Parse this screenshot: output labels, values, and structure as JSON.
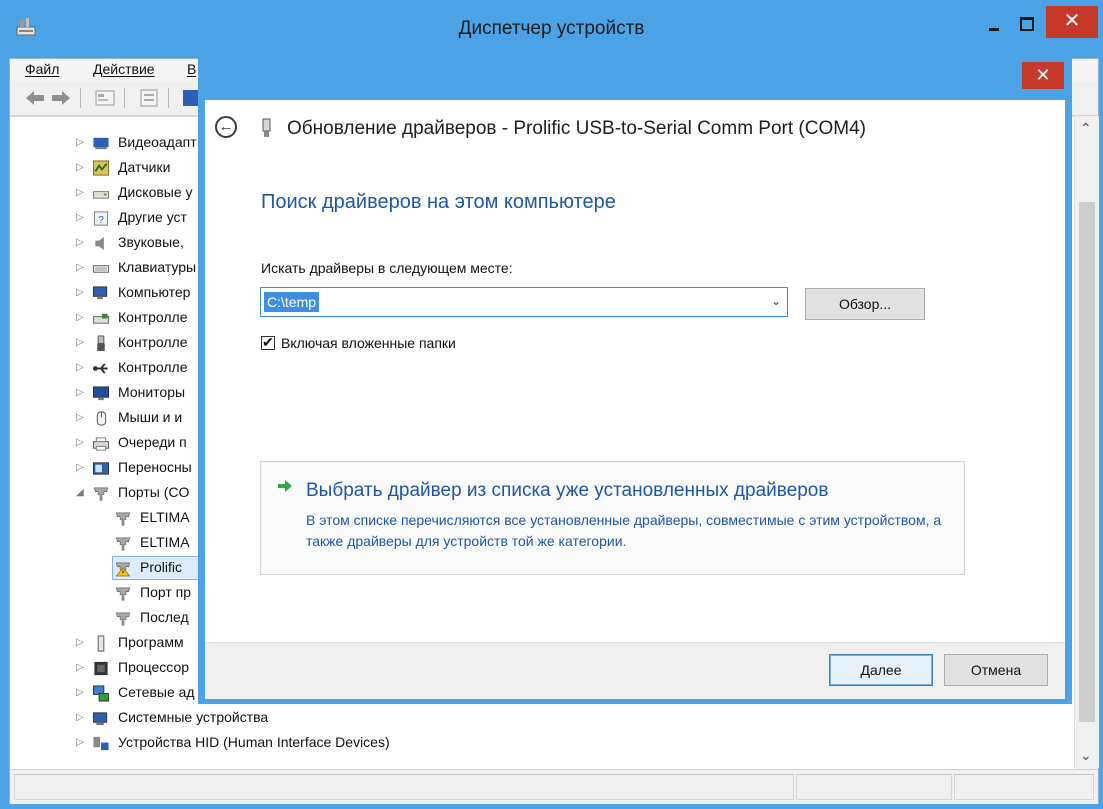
{
  "device_manager": {
    "title": "Диспетчер устройств",
    "close_glyph": "✕",
    "menu": [
      "Файл",
      "Действие",
      "В"
    ],
    "tree": [
      {
        "label": "Видеоадапт",
        "expander": "▷",
        "icon": "display-adapter-icon"
      },
      {
        "label": "Датчики",
        "expander": "▷",
        "icon": "sensor-icon"
      },
      {
        "label": "Дисковые у",
        "expander": "▷",
        "icon": "disk-drive-icon"
      },
      {
        "label": "Другие уст",
        "expander": "▷",
        "icon": "unknown-device-icon"
      },
      {
        "label": "Звуковые, ",
        "expander": "▷",
        "icon": "speaker-icon"
      },
      {
        "label": "Клавиатуры",
        "expander": "▷",
        "icon": "keyboard-icon"
      },
      {
        "label": "Компьютер",
        "expander": "▷",
        "icon": "computer-icon"
      },
      {
        "label": "Контролле",
        "expander": "▷",
        "icon": "storage-controller-icon"
      },
      {
        "label": "Контролле",
        "expander": "▷",
        "icon": "usb-plug-icon"
      },
      {
        "label": "Контролле",
        "expander": "▷",
        "icon": "usb-symbol-icon"
      },
      {
        "label": "Мониторы",
        "expander": "▷",
        "icon": "monitor-icon"
      },
      {
        "label": "Мыши и и",
        "expander": "▷",
        "icon": "mouse-icon"
      },
      {
        "label": "Очереди п",
        "expander": "▷",
        "icon": "printer-icon"
      },
      {
        "label": "Переносны",
        "expander": "▷",
        "icon": "portable-device-icon"
      },
      {
        "label": "Порты (CO",
        "expander": "◢",
        "icon": "port-icon"
      },
      {
        "label": "ELTIMA",
        "expander": "",
        "icon": "port-icon",
        "child": true
      },
      {
        "label": "ELTIMA",
        "expander": "",
        "icon": "port-icon",
        "child": true
      },
      {
        "label": "Prolific",
        "expander": "",
        "icon": "port-warning-icon",
        "child": true,
        "selected": true
      },
      {
        "label": "Порт пр",
        "expander": "",
        "icon": "port-icon",
        "child": true
      },
      {
        "label": "Послед",
        "expander": "",
        "icon": "port-icon",
        "child": true
      },
      {
        "label": "Программ",
        "expander": "▷",
        "icon": "software-device-icon"
      },
      {
        "label": "Процессор",
        "expander": "▷",
        "icon": "processor-icon"
      },
      {
        "label": "Сетевые ад",
        "expander": "▷",
        "icon": "network-adapter-icon"
      },
      {
        "label": "Системные устройства",
        "expander": "▷",
        "icon": "system-device-icon"
      },
      {
        "label": "Устройства HID (Human Interface Devices)",
        "expander": "▷",
        "icon": "hid-icon"
      }
    ]
  },
  "dialog": {
    "close_glyph": "✕",
    "back_glyph": "←",
    "title": "Обновление драйверов - Prolific USB-to-Serial Comm Port (COM4)",
    "heading": "Поиск драйверов на этом компьютере",
    "search_label": "Искать драйверы в следующем месте:",
    "path_value": "C:\\temp",
    "combo_arrow": "⌄",
    "browse_label": "Обзор...",
    "include_subfolders_label": "Включая вложенные папки",
    "include_subfolders_checked": true,
    "check_glyph": "✔",
    "pick_title": "Выбрать драйвер из списка уже установленных драйверов",
    "pick_desc": "В этом списке перечисляются все установленные драйверы, совместимые с этим устройством, а также драйверы для устройств той же категории.",
    "next_label": "Далее",
    "cancel_label": "Отмена"
  },
  "colors": {
    "window_frame": "#4ba3e6",
    "close_button": "#c7392b",
    "heading_blue": "#1e56a8",
    "selection": "#3f8fe0",
    "link_arrow": "#2aa84a"
  }
}
